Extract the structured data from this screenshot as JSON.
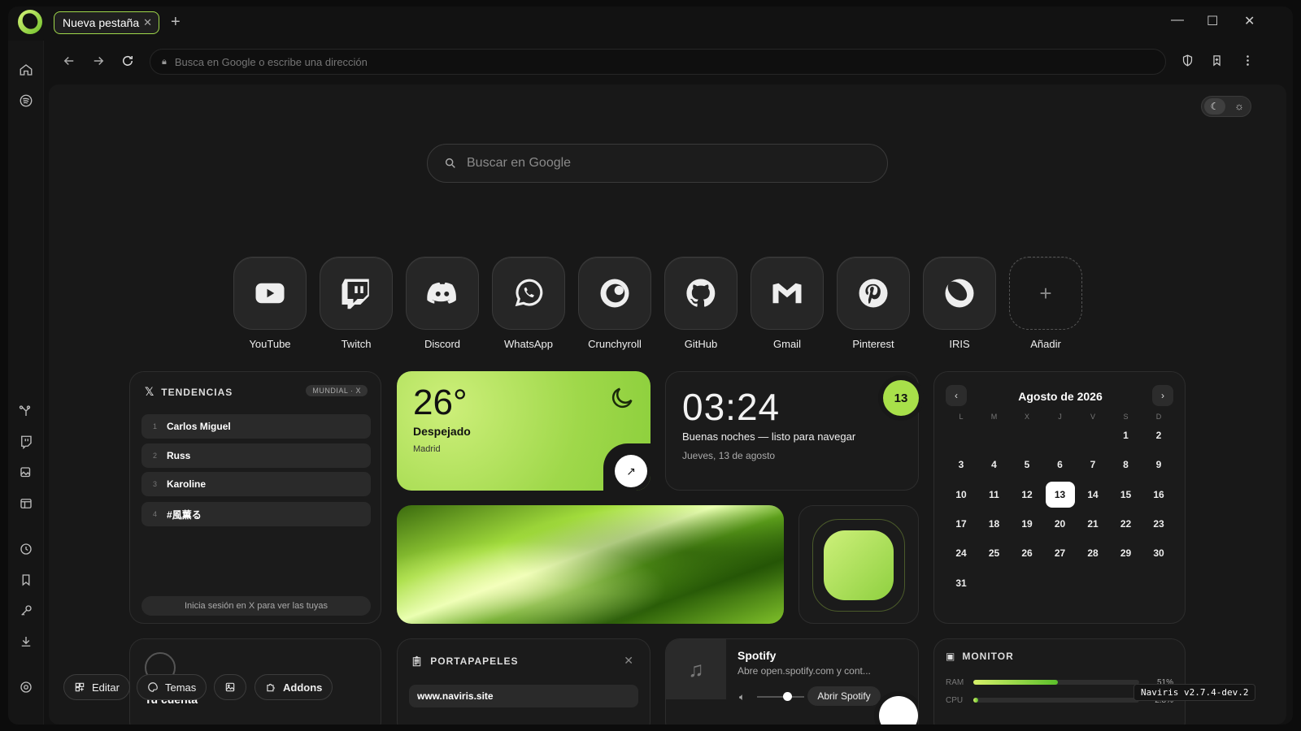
{
  "tab": {
    "title": "Nueva pestaña"
  },
  "toolbar": {
    "url_placeholder": "Busca en Google o escribe una dirección"
  },
  "search": {
    "placeholder": "Buscar en Google"
  },
  "shortcuts": [
    {
      "label": "YouTube",
      "icon": "youtube-icon"
    },
    {
      "label": "Twitch",
      "icon": "twitch-icon"
    },
    {
      "label": "Discord",
      "icon": "discord-icon"
    },
    {
      "label": "WhatsApp",
      "icon": "whatsapp-icon"
    },
    {
      "label": "Crunchyroll",
      "icon": "crunchyroll-icon"
    },
    {
      "label": "GitHub",
      "icon": "github-icon"
    },
    {
      "label": "Gmail",
      "icon": "gmail-icon"
    },
    {
      "label": "Pinterest",
      "icon": "pinterest-icon"
    },
    {
      "label": "IRIS",
      "icon": "iris-icon"
    },
    {
      "label": "Añadir",
      "icon": "plus-icon"
    }
  ],
  "trends": {
    "title": "TENDENCIAS",
    "badge": "MUNDIAL · X",
    "items": [
      {
        "n": "1",
        "label": "Carlos Miguel"
      },
      {
        "n": "2",
        "label": "Russ"
      },
      {
        "n": "3",
        "label": "Karoline"
      },
      {
        "n": "4",
        "label": "#風薫る"
      }
    ],
    "footer": "Inicia sesión en X para ver las tuyas"
  },
  "weather": {
    "temp": "26°",
    "condition": "Despejado",
    "city": "Madrid"
  },
  "clock": {
    "time": "03:24",
    "message": "Buenas noches — listo para navegar",
    "date": "Jueves, 13 de agosto",
    "day_badge": "13"
  },
  "calendar": {
    "month": "Agosto de 2026",
    "weekdays": [
      "L",
      "M",
      "X",
      "J",
      "V",
      "S",
      "D"
    ],
    "days": [
      "1",
      "2",
      "3",
      "4",
      "5",
      "6",
      "7",
      "8",
      "9",
      "10",
      "11",
      "12",
      "13",
      "14",
      "15",
      "16",
      "17",
      "18",
      "19",
      "20",
      "21",
      "22",
      "23",
      "24",
      "25",
      "26",
      "27",
      "28",
      "29",
      "30",
      "31"
    ],
    "first_weekday_index": 5,
    "today": "13"
  },
  "account": {
    "title": "Tu cuenta"
  },
  "clipboard": {
    "title": "PORTAPAPELES",
    "item": "www.naviris.site"
  },
  "spotify": {
    "title": "Spotify",
    "subtitle": "Abre open.spotify.com y cont...",
    "button": "Abrir Spotify"
  },
  "monitor": {
    "title": "MONITOR",
    "ram_label": "RAM",
    "ram_value": "51%",
    "ram_fraction": 0.51,
    "cpu_label": "CPU",
    "cpu_value": "2.8%",
    "cpu_fraction": 0.028
  },
  "bottom_bar": {
    "edit": "Editar",
    "themes": "Temas",
    "addons": "Addons"
  },
  "version": "Naviris v2.7.4-dev.2"
}
